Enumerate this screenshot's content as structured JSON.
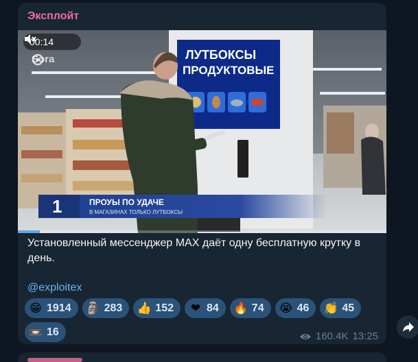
{
  "channel": {
    "name": "Эксплойт"
  },
  "video": {
    "duration": "00:14",
    "watermark": "Sora",
    "screen_title_line1": "ЛУТБОКСЫ",
    "screen_title_line2": "ПРОДУКТОВЫЕ",
    "tv_title": "ПРОУЫ ПО УДАЧЕ",
    "tv_subtitle": "В МАГАЗИНАХ ТОЛЬКО ЛУТБОКСЫ",
    "progress_fraction": 0.06
  },
  "post": {
    "text": "Установленный мессенджер MAX даёт одну бесплатную крутку в день.",
    "mention": "@exploitex"
  },
  "reactions": [
    {
      "icon": "grinning-face",
      "glyph": "😁",
      "count": "1914"
    },
    {
      "icon": "moai",
      "glyph": "🗿",
      "count": "283"
    },
    {
      "icon": "thumbs-up",
      "glyph": "👍",
      "count": "152"
    },
    {
      "icon": "red-heart",
      "glyph": "❤",
      "count": "84"
    },
    {
      "icon": "fire",
      "glyph": "🔥",
      "count": "74"
    },
    {
      "icon": "crying-face",
      "glyph": "😭",
      "count": "46"
    },
    {
      "icon": "clapping-hands",
      "glyph": "👏",
      "count": "45"
    },
    {
      "icon": "cassette-tape",
      "glyph": "📼",
      "count": "16"
    }
  ],
  "meta": {
    "views": "160.4K",
    "time": "13:25"
  },
  "colors": {
    "accent": "#6ab3f3",
    "author": "#ee6f9c",
    "bubble": "#182533",
    "background": "#0e1621"
  }
}
